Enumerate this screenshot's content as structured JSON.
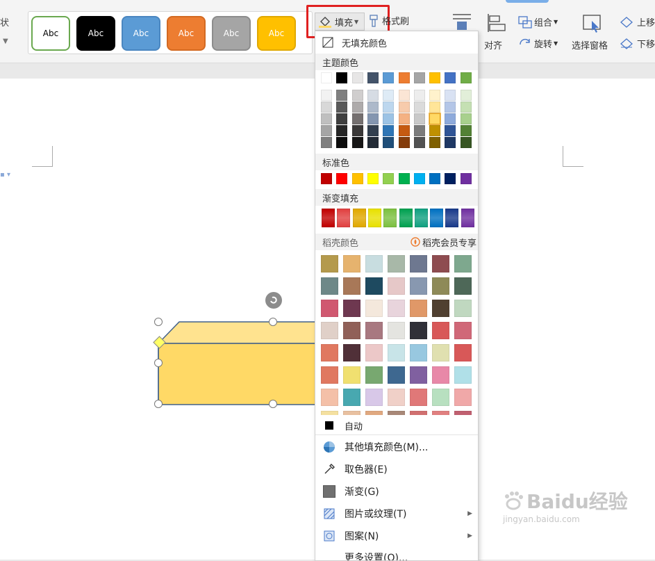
{
  "ribbon": {
    "left_cut_label": "状",
    "style_swatches": [
      {
        "label": "Abc",
        "bg": "#ffffff",
        "border": "#6aa84f",
        "text": "#000000"
      },
      {
        "label": "Abc",
        "bg": "#000000",
        "border": "#000000",
        "text": "#ffffff"
      },
      {
        "label": "Abc",
        "bg": "#5b9bd5",
        "border": "#4a86c0",
        "text": "#ffffff"
      },
      {
        "label": "Abc",
        "bg": "#ed7d31",
        "border": "#d36a22",
        "text": "#ffffff"
      },
      {
        "label": "Abc",
        "bg": "#a5a5a5",
        "border": "#8c8c8c",
        "text": "#ffffff"
      },
      {
        "label": "Abc",
        "bg": "#ffc000",
        "border": "#e0a800",
        "text": "#ffffff"
      }
    ],
    "fill_label": "填充",
    "format_painter_label": "格式刷",
    "align_label": "对齐",
    "group_label": "组合",
    "rotate_label": "旋转",
    "selection_pane_label": "选择窗格",
    "bring_forward_label": "上移",
    "send_backward_label": "下移"
  },
  "menu": {
    "no_fill": "无填充颜色",
    "theme_colors_title": "主题颜色",
    "theme_top": [
      "#ffffff",
      "#000000",
      "#e7e6e6",
      "#44546a",
      "#5b9bd5",
      "#ed7d31",
      "#a5a5a5",
      "#ffc000",
      "#4472c4",
      "#70ad47"
    ],
    "theme_shades": [
      [
        "#f2f2f2",
        "#7f7f7f",
        "#d0cece",
        "#d6dce4",
        "#deebf6",
        "#fbe5d5",
        "#ededed",
        "#fff2cc",
        "#d9e2f3",
        "#e2efd9"
      ],
      [
        "#d8d8d8",
        "#595959",
        "#aeabab",
        "#adb9ca",
        "#bdd7ee",
        "#f7cbac",
        "#dbdbdb",
        "#ffe598",
        "#b4c6e7",
        "#c5e0b3"
      ],
      [
        "#bfbfbf",
        "#3f3f3f",
        "#757070",
        "#8496b0",
        "#9cc3e5",
        "#f4b183",
        "#c9c9c9",
        "#ffd965",
        "#8eaadb",
        "#a8d08d"
      ],
      [
        "#a5a5a5",
        "#262626",
        "#3a3838",
        "#323f4f",
        "#2e75b5",
        "#c55a11",
        "#7b7b7b",
        "#bf9000",
        "#2f5496",
        "#538135"
      ],
      [
        "#7f7f7f",
        "#0c0c0c",
        "#171616",
        "#222a35",
        "#1f4e79",
        "#843c0b",
        "#525252",
        "#7f6000",
        "#1f3864",
        "#375623"
      ]
    ],
    "standard_colors_title": "标准色",
    "standard_colors": [
      "#c00000",
      "#ff0000",
      "#ffc000",
      "#ffff00",
      "#92d050",
      "#00b050",
      "#00b0f0",
      "#0070c0",
      "#002060",
      "#7030a0"
    ],
    "gradient_fill_title": "渐变填充",
    "gradient_colors": [
      "#c00000",
      "#e04040",
      "#e0a800",
      "#e8e000",
      "#7cc040",
      "#00a050",
      "#10a080",
      "#0070c0",
      "#1a3a8a",
      "#7030a0"
    ],
    "daoke_colors_title": "稻壳颜色",
    "daoke_member_label": "稻壳会员专享",
    "texture_colors": [
      [
        "#b49a4c",
        "#e6b36e",
        "#c8dde0",
        "#a8b8a8",
        "#6e7890",
        "#8e4c50",
        "#7ea88e"
      ],
      [
        "#6e8888",
        "#a87858",
        "#1e4a60",
        "#e6c8c8",
        "#8898b0",
        "#8e8a58",
        "#4e6858"
      ],
      [
        "#d05870",
        "#6e3850",
        "#f4e8dc",
        "#e8d4dc",
        "#e09868",
        "#504030",
        "#c0d8c0"
      ],
      [
        "#e0d0c8",
        "#906058",
        "#a87880",
        "#e4e4e0",
        "#303038",
        "#d85858",
        "#d06878"
      ],
      [
        "#e07860",
        "#503038",
        "#ecc8c8",
        "#c8e4e8",
        "#98c8e0",
        "#e0e0b0",
        "#d85858"
      ],
      [
        "#e07860",
        "#f0e070",
        "#78a870",
        "#3e6890",
        "#8060a0",
        "#e888a8",
        "#b0e0e8"
      ],
      [
        "#f4c0a8",
        "#48a8b0",
        "#d8c8e8",
        "#f0d0c8",
        "#e07878",
        "#b8e0c0",
        "#f0a8a8"
      ],
      [
        "#f4e0a0",
        "#e8c0a0",
        "#e0a880",
        "#a88878",
        "#d07070",
        "#e08080",
        "#c06070"
      ]
    ],
    "auto_label": "自动",
    "more_fill_colors": "其他填充颜色(M)...",
    "eyedropper": "取色器(E)",
    "gradient": "渐变(G)",
    "picture_texture": "图片或纹理(T)",
    "pattern": "图案(N)",
    "more_settings": "更多设置(O)..."
  },
  "shape": {
    "fill": "#ffd966",
    "top_fill": "#ffe38f",
    "stroke": "#41608a"
  },
  "watermark": {
    "brand": "Baidu经验",
    "url": "jingyan.baidu.com"
  }
}
